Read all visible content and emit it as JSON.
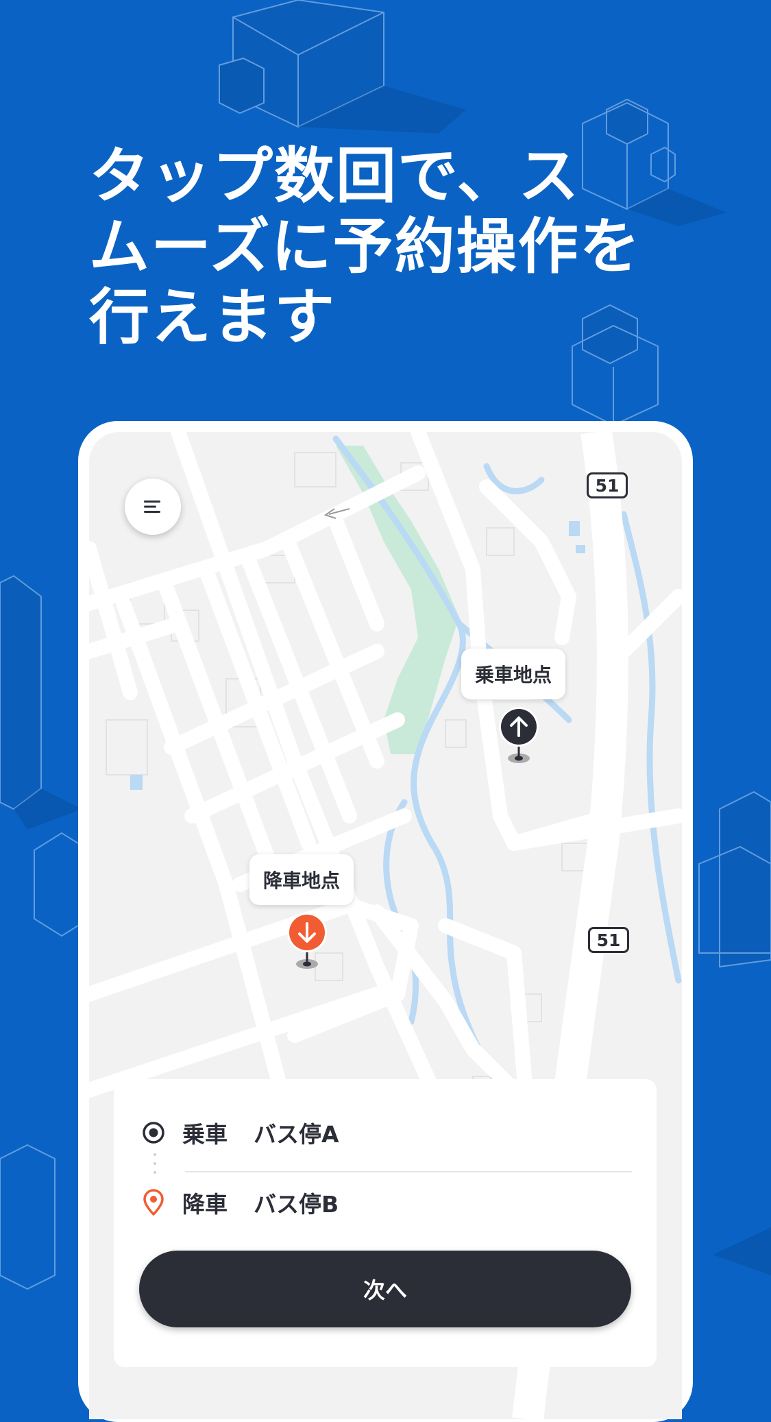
{
  "headline": {
    "line1": "タップ数回で、ス",
    "line2": "ムーズに予約操作を",
    "line3": "行えます"
  },
  "map": {
    "route_shield_top": "51",
    "route_shield_bottom": "51",
    "pickup_pin_label": "乗車地点",
    "dropoff_pin_label": "降車地点",
    "pickup_pin_icon": "arrow-up-icon",
    "dropoff_pin_icon": "arrow-down-icon",
    "menu_icon": "hamburger-menu-icon"
  },
  "booking_panel": {
    "pickup_label": "乗車",
    "pickup_value": "バス停A",
    "dropoff_label": "降車",
    "dropoff_value": "バス停B",
    "next_button": "次へ"
  },
  "colors": {
    "background": "#0a63c4",
    "dark": "#2b2e37",
    "accent_orange": "#f25c33",
    "map_bg": "#f2f2f2",
    "water": "#b9d9f4",
    "park": "#c9ead9"
  }
}
